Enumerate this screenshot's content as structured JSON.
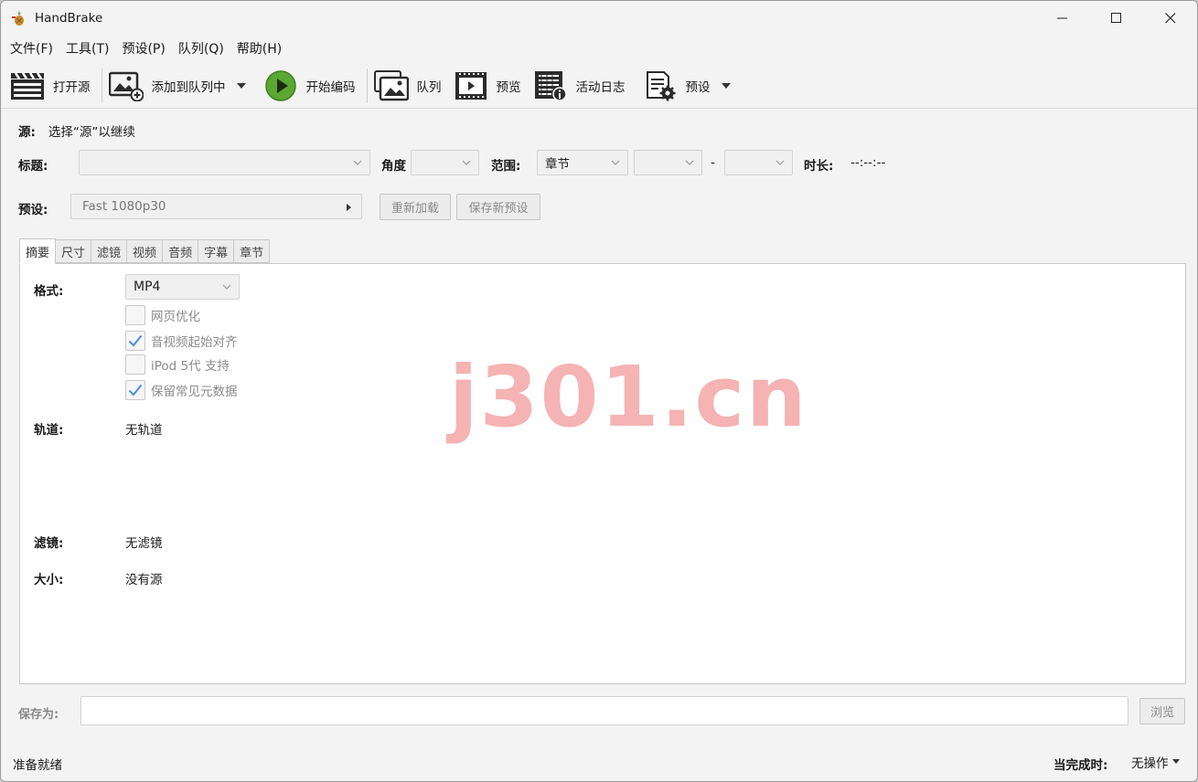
{
  "window": {
    "title": "HandBrake"
  },
  "menu": [
    "文件(F)",
    "工具(T)",
    "预设(P)",
    "队列(Q)",
    "帮助(H)"
  ],
  "toolbar": {
    "open_source": "打开源",
    "add_to_queue": "添加到队列中",
    "start_encode": "开始编码",
    "queue": "队列",
    "preview": "预览",
    "activity_log": "活动日志",
    "presets": "预设"
  },
  "source": {
    "label": "源:",
    "value": "选择“源”以继续"
  },
  "title_row": {
    "title_label": "标题:",
    "title_value": "",
    "angle_label": "角度",
    "angle_value": "",
    "range_label": "范围:",
    "range_mode": "章节",
    "range_start": "",
    "range_sep": "-",
    "range_end": "",
    "duration_label": "时长:",
    "duration_value": "--:--:--"
  },
  "preset_row": {
    "label": "预设:",
    "value": "Fast 1080p30",
    "reload_button": "重新加载",
    "save_new_button": "保存新预设"
  },
  "tabs": [
    "摘要",
    "尺寸",
    "滤镜",
    "视频",
    "音频",
    "字幕",
    "章节"
  ],
  "summary": {
    "format_label": "格式:",
    "format_value": "MP4",
    "options": [
      {
        "label": "网页优化",
        "checked": false
      },
      {
        "label": "音视频起始对齐",
        "checked": true
      },
      {
        "label": "iPod 5代 支持",
        "checked": false
      },
      {
        "label": "保留常见元数据",
        "checked": true
      }
    ],
    "tracks_label": "轨道:",
    "tracks_value": "无轨道",
    "filters_label": "滤镜:",
    "filters_value": "无滤镜",
    "size_label": "大小:",
    "size_value": "没有源"
  },
  "save_as": {
    "label": "保存为:",
    "value": "",
    "browse_button": "浏览"
  },
  "status": {
    "text": "准备就绪",
    "when_done_label": "当完成时:",
    "when_done_value": "无操作"
  },
  "watermark": "j301.cn",
  "colors": {
    "accent_green": "#5aa832",
    "check_blue": "#4a8fd8",
    "watermark": "#f4a6a6",
    "chrome_bg": "#f3f3f3"
  }
}
